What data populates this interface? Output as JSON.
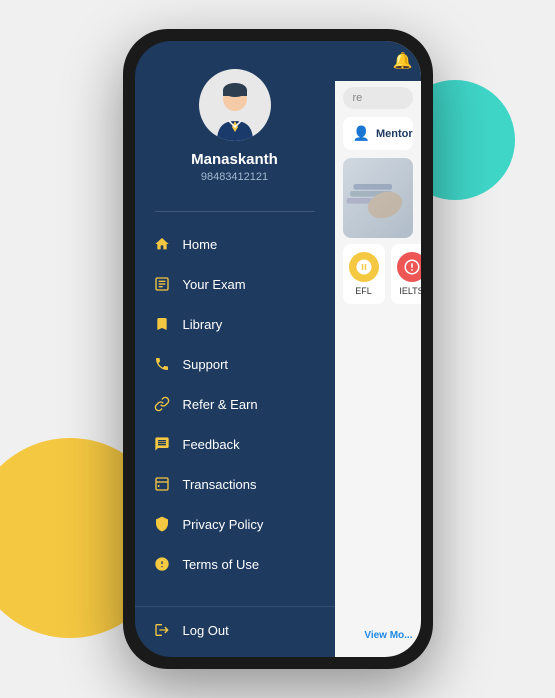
{
  "background": {
    "circle_yellow": "yellow background circle",
    "circle_teal": "teal background circle"
  },
  "profile": {
    "name": "Manaskanth",
    "phone": "98483412121"
  },
  "nav": {
    "items": [
      {
        "id": "home",
        "label": "Home",
        "icon": "🏠"
      },
      {
        "id": "your-exam",
        "label": "Your Exam",
        "icon": "📋"
      },
      {
        "id": "library",
        "label": "Library",
        "icon": "🔖"
      },
      {
        "id": "support",
        "label": "Support",
        "icon": "📞"
      },
      {
        "id": "refer-earn",
        "label": "Refer & Earn",
        "icon": "🔗"
      },
      {
        "id": "feedback",
        "label": "Feedback",
        "icon": "📝"
      },
      {
        "id": "transactions",
        "label": "Transactions",
        "icon": "📊"
      },
      {
        "id": "privacy-policy",
        "label": "Privacy Policy",
        "icon": "🛡"
      },
      {
        "id": "terms-of-use",
        "label": "Terms of Use",
        "icon": "ℹ"
      }
    ],
    "logout": {
      "label": "Log Out",
      "icon": "🚪"
    }
  },
  "main": {
    "mentor_label": "Mentor",
    "search_placeholder": "re",
    "view_more": "View Mo...",
    "exam_cards": [
      {
        "label": "EFL"
      },
      {
        "label": "IELTS"
      }
    ]
  }
}
